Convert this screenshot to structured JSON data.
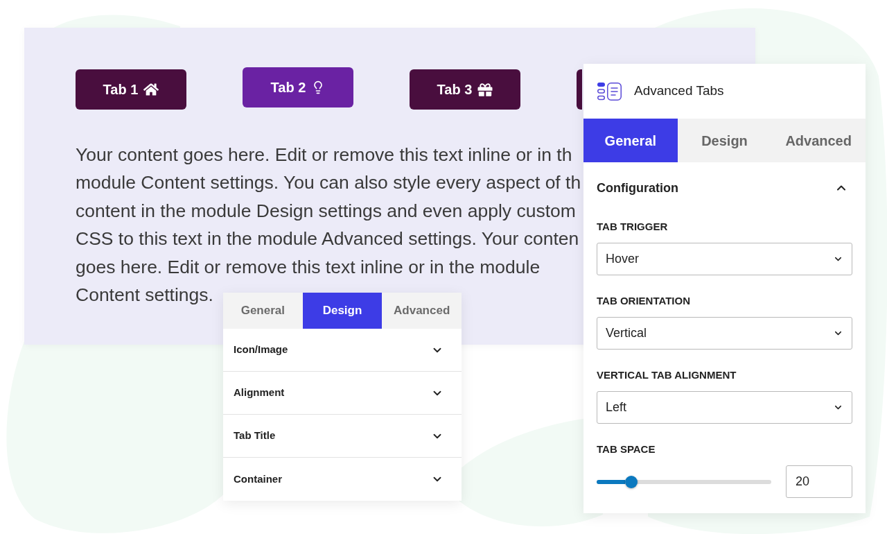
{
  "preview": {
    "tabs": [
      {
        "label": "Tab 1",
        "selected": false
      },
      {
        "label": "Tab 2",
        "selected": true
      },
      {
        "label": "Tab 3",
        "selected": false
      },
      {
        "selected": false
      }
    ],
    "paragraph_lines": [
      "Your content goes here. Edit or remove this text inline or in th",
      "module Content settings. You can also style every aspect of th",
      "content in the module Design settings and even apply custom",
      "CSS to this text in the module Advanced settings. Your conten",
      "goes here. Edit or remove this text inline or in the module",
      "Content settings."
    ]
  },
  "design_panel": {
    "tabs": [
      {
        "label": "General",
        "selected": false
      },
      {
        "label": "Design",
        "selected": true
      },
      {
        "label": "Advanced",
        "selected": false
      }
    ],
    "sections": [
      {
        "title": "Icon/Image",
        "expanded": false
      },
      {
        "title": "Alignment",
        "expanded": false
      },
      {
        "title": "Tab Title",
        "expanded": false
      },
      {
        "title": "Container",
        "expanded": false
      }
    ]
  },
  "settings_panel": {
    "title": "Advanced Tabs",
    "tabs": [
      {
        "label": "General",
        "selected": true
      },
      {
        "label": "Design",
        "selected": false
      },
      {
        "label": "Advanced",
        "selected": false
      }
    ],
    "section": {
      "title": "Configuration",
      "expanded": true
    },
    "fields": [
      {
        "kind": "select",
        "label": "TAB TRIGGER",
        "value": "Hover"
      },
      {
        "kind": "select",
        "label": "TAB ORIENTATION",
        "value": "Vertical"
      },
      {
        "kind": "select",
        "label": "VERTICAL TAB ALIGNMENT",
        "value": "Left"
      },
      {
        "kind": "slider",
        "label": "TAB SPACE",
        "level": 0.2,
        "value": "20"
      }
    ]
  }
}
